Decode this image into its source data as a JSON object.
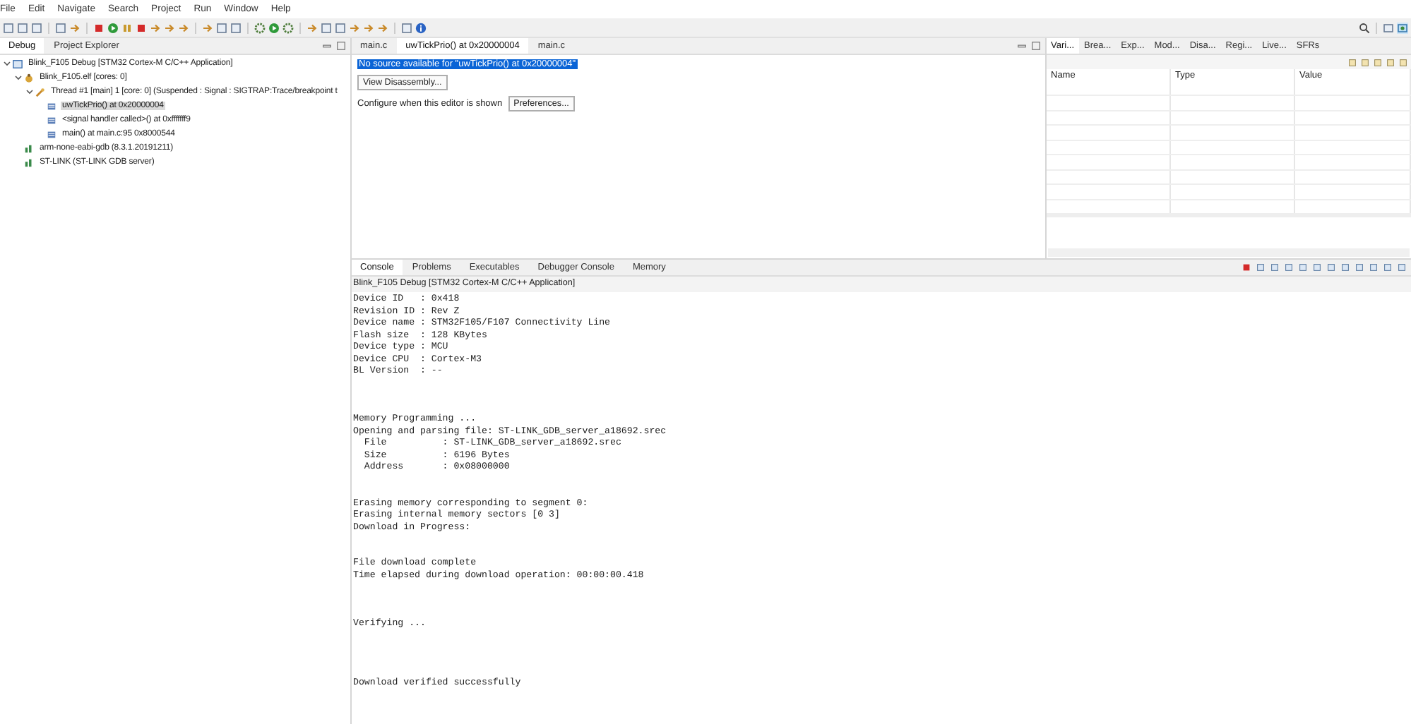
{
  "menu": [
    "File",
    "Edit",
    "Navigate",
    "Search",
    "Project",
    "Run",
    "Window",
    "Help"
  ],
  "debug_panel": {
    "tabs": [
      {
        "label": "Debug",
        "selected": true
      },
      {
        "label": "Project Explorer",
        "selected": false
      }
    ],
    "tree": [
      {
        "kind": "launch",
        "label": "Blink_F105 Debug [STM32 Cortex-M C/C++ Application]",
        "expanded": true,
        "selected": false,
        "children": [
          {
            "kind": "elf",
            "label": "Blink_F105.elf [cores: 0]",
            "expanded": true,
            "selected": false,
            "children": [
              {
                "kind": "thread",
                "label": "Thread #1 [main] 1 [core: 0] (Suspended : Signal : SIGTRAP:Trace/breakpoint t",
                "expanded": true,
                "selected": false,
                "children": [
                  {
                    "kind": "frame",
                    "label": "uwTickPrio() at 0x20000004",
                    "selected": true
                  },
                  {
                    "kind": "frame",
                    "label": "<signal handler called>() at 0xfffffff9",
                    "selected": false
                  },
                  {
                    "kind": "frame",
                    "label": "main() at main.c:95 0x8000544",
                    "selected": false
                  }
                ]
              }
            ]
          },
          {
            "kind": "process",
            "label": "arm-none-eabi-gdb (8.3.1.20191211)",
            "selected": false
          },
          {
            "kind": "process",
            "label": "ST-LINK (ST-LINK GDB server)",
            "selected": false
          }
        ]
      }
    ]
  },
  "editor": {
    "tabs": [
      {
        "label": "main.c",
        "selected": false
      },
      {
        "label": "uwTickPrio() at 0x20000004",
        "selected": true
      },
      {
        "label": "main.c",
        "selected": false
      }
    ],
    "message": "No source available for \"uwTickPrio() at 0x20000004\"",
    "disassembly_button": "View Disassembly...",
    "configure_label": "Configure when this editor is shown",
    "preferences_button": "Preferences..."
  },
  "variables_panel": {
    "tabs": [
      {
        "label": "Vari...",
        "selected": true
      },
      {
        "label": "Brea...",
        "selected": false
      },
      {
        "label": "Exp...",
        "selected": false
      },
      {
        "label": "Mod...",
        "selected": false
      },
      {
        "label": "Disa...",
        "selected": false
      },
      {
        "label": "Regi...",
        "selected": false
      },
      {
        "label": "Live...",
        "selected": false
      },
      {
        "label": "SFRs",
        "selected": false
      }
    ],
    "columns": [
      "Name",
      "Type",
      "Value"
    ]
  },
  "console": {
    "tabs": [
      {
        "label": "Console",
        "selected": true
      },
      {
        "label": "Problems",
        "selected": false
      },
      {
        "label": "Executables",
        "selected": false
      },
      {
        "label": "Debugger Console",
        "selected": false
      },
      {
        "label": "Memory",
        "selected": false
      }
    ],
    "title": "Blink_F105 Debug [STM32 Cortex-M C/C++ Application]",
    "blocks": [
      [
        "Device ID   : 0x418",
        "Revision ID : Rev Z",
        "Device name : STM32F105/F107 Connectivity Line",
        "Flash size  : 128 KBytes",
        "Device type : MCU",
        "Device CPU  : Cortex-M3",
        "BL Version  : --"
      ],
      [
        "Memory Programming ...",
        "Opening and parsing file: ST-LINK_GDB_server_a18692.srec",
        "  File          : ST-LINK_GDB_server_a18692.srec",
        "  Size          : 6196 Bytes",
        "  Address       : 0x08000000"
      ],
      [
        "Erasing memory corresponding to segment 0:",
        "Erasing internal memory sectors [0 3]",
        "Download in Progress:"
      ],
      [
        "File download complete",
        "Time elapsed during download operation: 00:00:00.418"
      ],
      [
        "Verifying ..."
      ],
      [
        "Download verified successfully"
      ]
    ]
  }
}
